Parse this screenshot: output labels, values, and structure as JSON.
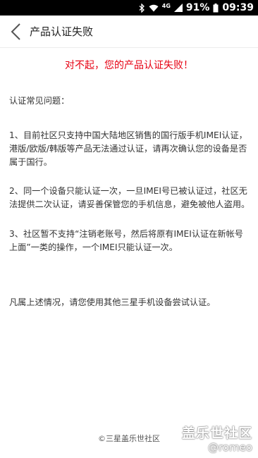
{
  "status_bar": {
    "network": "4G",
    "battery": "91%",
    "time": "09:39"
  },
  "header": {
    "title": "产品认证失败"
  },
  "content": {
    "error_heading": "对不起，您的产品认证失败！",
    "faq_title": "认证常见问题：",
    "items": [
      "1、目前社区只支持中国大陆地区销售的国行版手机IMEI认证，港版/欧版/韩版等产品无法通过认证，请再次确认您的设备是否属于国行。",
      "2、同一个设备只能认证一次，一旦IMEI号已被认证过，社区无法提供二次认证，请妥善保管您的手机信息，避免被他人盗用。",
      "3、社区暂不支持“注销老账号，然后将原有IMEI认证在新帐号上面”一类的操作，一个IMEI只能认证一次。"
    ],
    "closing": "凡属上述情况，请您使用其他三星手机设备尝试认证。"
  },
  "footer": {
    "copyright": "©三星盖乐世社区"
  },
  "watermark": {
    "brand": "盖乐世社区",
    "user": "@romeo"
  },
  "icons": {
    "back": "back-chevron-icon",
    "bluetooth": "bluetooth-icon",
    "wifi": "wifi-icon",
    "signal": "signal-icon"
  },
  "colors": {
    "error_text": "#e60012",
    "status_bar_bg": "#000000",
    "body_text": "#333333"
  }
}
